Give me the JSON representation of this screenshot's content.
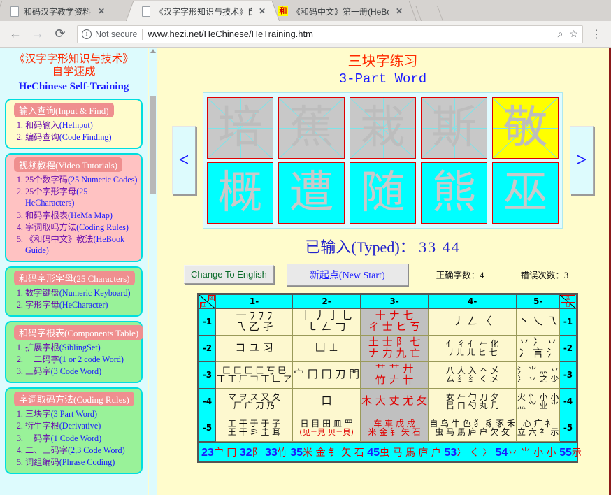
{
  "browser": {
    "tabs": [
      {
        "title": "和码汉字教学资料",
        "favicon": "doc-icon",
        "active": false,
        "close_label": "✕"
      },
      {
        "title": "《汉字字形知识与技术》自",
        "favicon": "doc-icon",
        "active": true,
        "close_label": "✕"
      },
      {
        "title": "《和码中文》第一册(HeBoo",
        "favicon": "he-icon",
        "favicon_text": "和",
        "active": false,
        "close_label": "✕"
      }
    ],
    "newtab_label": "",
    "toolbar": {
      "back_icon": "←",
      "forward_icon": "→",
      "reload_icon": "⟳",
      "security_label": "Not secure",
      "url_host": "www.hezi.net",
      "url_path": "/HeChinese/HeTraining.htm",
      "zoom_icon": "⌕",
      "bookmark_icon": "☆",
      "menu_icon": "⋮"
    }
  },
  "sidebar": {
    "title_line1": "《汉字字形知识与技术》",
    "title_line2": "自学速成",
    "title_line3": "HeChinese Self-Training",
    "cards": [
      {
        "head": "输入查询(Input & Find)",
        "theme": "yellow",
        "items": [
          {
            "cn": "和码输入",
            "en": "(HeInput)"
          },
          {
            "cn": "编码查询",
            "en": "(Code Finding)"
          }
        ]
      },
      {
        "head": "视频教程(Video Tutorials)",
        "theme": "pink",
        "items": [
          {
            "cn": "25个数字码",
            "en": "(25 Numeric Codes)"
          },
          {
            "cn": "25个字形字母",
            "en": "(25 HeCharacters)"
          },
          {
            "cn": "和码字根表",
            "en": "(HeMa Map)"
          },
          {
            "cn": "字词取吗方法",
            "en": "(Coding Rules)"
          },
          {
            "cn": "《和码中文》教法",
            "en": "(HeBook Guide)"
          }
        ]
      },
      {
        "head": "和码字形字母(25 Characters)",
        "theme": "green",
        "items": [
          {
            "cn": "数字键盘",
            "en": "(Numeric Keyboard)"
          },
          {
            "cn": "字形字母",
            "en": "(HeCharacter)"
          }
        ]
      },
      {
        "head": "和码字根表(Components Table)",
        "theme": "green",
        "items": [
          {
            "cn": "扩展字根",
            "en": "(SiblingSet)"
          },
          {
            "cn": "一二码字",
            "en": "(1 or 2 code Word)"
          },
          {
            "cn": "三码字",
            "en": "(3 Code Word)"
          }
        ]
      },
      {
        "head": "字词取码方法(Coding Rules)",
        "theme": "green",
        "items": [
          {
            "cn": "三块字",
            "en": "(3 Part Word)"
          },
          {
            "cn": "衍生字根",
            "en": "(Derivative)"
          },
          {
            "cn": "一码字",
            "en": "(1 Code Word)"
          },
          {
            "cn": "二、三码字",
            "en": "(2,3 Code Word)"
          },
          {
            "cn": "词组编码",
            "en": "(Phrase Coding)"
          }
        ]
      }
    ]
  },
  "main": {
    "title_cn": "三块字练习",
    "title_en": "3-Part Word",
    "prev_arrow": "<",
    "next_arrow": ">",
    "exercise_grid": {
      "row1": [
        {
          "char": "培",
          "bg": "gray"
        },
        {
          "char": "蕉",
          "bg": "gray"
        },
        {
          "char": "栽",
          "bg": "gray"
        },
        {
          "char": "斯",
          "bg": "gray"
        },
        {
          "char": "敬",
          "bg": "yellow"
        }
      ],
      "row2": [
        {
          "char": "概",
          "bg": "cyan"
        },
        {
          "char": "遭",
          "bg": "cyan"
        },
        {
          "char": "随",
          "bg": "cyan"
        },
        {
          "char": "熊",
          "bg": "cyan"
        },
        {
          "char": "巫",
          "bg": "cyan"
        }
      ]
    },
    "typed_label": "已输入(Typed)：",
    "typed_value": "33 44",
    "buttons": {
      "change_language": "Change To English",
      "new_start": "新起点(New Start)"
    },
    "stats": {
      "correct_label": "正确字数：",
      "correct_value": "4",
      "error_label": "错误次数：",
      "error_value": "3"
    }
  },
  "components_table": {
    "corner_label": "位",
    "columns": [
      "1-",
      "2-",
      "3-",
      "4-",
      "5-"
    ],
    "rows": [
      {
        "label": "-1",
        "cells": [
          {
            "line1": "一 ﾌ ﾌ ﾌ",
            "line2": "乁 乙 孑",
            "selected": false
          },
          {
            "line1": "丨 丿 亅 乚",
            "line2": "㇄ 𠃋 𠃌",
            "selected": false
          },
          {
            "line1": "十 ナ 七",
            "line2": "ㄔ 士 ヒ ㄎ",
            "selected": true
          },
          {
            "line1": "丿 ㄥ 〈",
            "line2": "",
            "selected": false
          },
          {
            "line1": "丶 乀 乁",
            "line2": "",
            "selected": false
          }
        ]
      },
      {
        "label": "-2",
        "cells": [
          {
            "line1": "コ ユ 习",
            "line2": "",
            "selected": false
          },
          {
            "line1": "凵 ⊥",
            "line2": "",
            "selected": false
          },
          {
            "line1": "土 士 阝 七",
            "line2": "ナ 力 九 亡",
            "selected": true
          },
          {
            "line1": "亻 彳 亻 𠂉 化",
            "line2": "丿ㄦ ㄦ ヒ 七",
            "selected": false
          },
          {
            "line1": "丷 冫 丷",
            "line2": "冫 言 氵",
            "selected": false
          }
        ]
      },
      {
        "label": "-3",
        "cells": [
          {
            "line1": "匚 匚 匚 匚 丂 巳",
            "line2": "丁 丁 厂 𠃌 丁 𠃊 ア",
            "selected": false
          },
          {
            "line1": "宀 冂 冂 刀 門",
            "line2": "",
            "selected": false
          },
          {
            "line1": "艹 艹 廾",
            "line2": "竹 𠂇 卄",
            "selected": true
          },
          {
            "line1": "八 人 入 𠆢 乄",
            "line2": "厶 纟 纟 く 乄",
            "selected": false
          },
          {
            "line1": "氵 ⺌ 灬 丷",
            "line2": "冫 丷 之 少",
            "selected": false
          }
        ]
      },
      {
        "label": "-4",
        "cells": [
          {
            "line1": "マ ヲ ス 又 夂",
            "line2": "厂 广 刀 乃",
            "selected": false
          },
          {
            "line1": "口",
            "line2": "",
            "selected": false
          },
          {
            "line1": "木 大 丈 尤 攵",
            "line2": "",
            "selected": true
          },
          {
            "line1": "女 𠂉 勹 刀 夕",
            "line2": "㠯 口 勺 丸 几",
            "selected": false
          },
          {
            "line1": "火 忄 小 小",
            "line2": "灬 ⺍ 业 ⺌",
            "selected": false
          }
        ]
      },
      {
        "label": "-5",
        "cells": [
          {
            "line1": "工 干 于 于 子",
            "line2": "王 干 丯 圭 耳",
            "selected": false
          },
          {
            "line1": "日 目 田 皿 罒",
            "line2": "(见=見 贝=貝)",
            "selected": false,
            "note": true
          },
          {
            "line1": "车 車 戊 戍",
            "line2": "米 金 钅 矢 石",
            "selected": true
          },
          {
            "line1": "自 鸟 牛 色 犭 豸 豕 禾",
            "line2": "虫 马 馬 庐 户 欠 攵",
            "selected": false
          },
          {
            "line1": "心 疒 衤",
            "line2": "立 六 礻 示",
            "selected": false
          }
        ]
      }
    ],
    "footer": [
      {
        "code": "23",
        "glyphs": "宀 冂"
      },
      {
        "code": "32",
        "glyphs": "阝"
      },
      {
        "code": "33",
        "glyphs": "竹"
      },
      {
        "code": "35",
        "glyphs": "米 金 钅 矢 石"
      },
      {
        "code": "45",
        "glyphs": "虫 马 馬 庐 户"
      },
      {
        "code": "53",
        "glyphs": "冫 く 冫"
      },
      {
        "code": "54",
        "glyphs": "丷 ⺌ 小 小"
      },
      {
        "code": "55",
        "glyphs": "示"
      }
    ]
  },
  "colors": {
    "sidebar_bg": "#ddfbfd",
    "main_bg": "#fffccc",
    "accent_red": "#ff2a00",
    "accent_blue": "#1a1aff",
    "cyan": "#00ffff",
    "selected_gray": "#c0c0c0",
    "table_body": "#fdf8cf"
  }
}
